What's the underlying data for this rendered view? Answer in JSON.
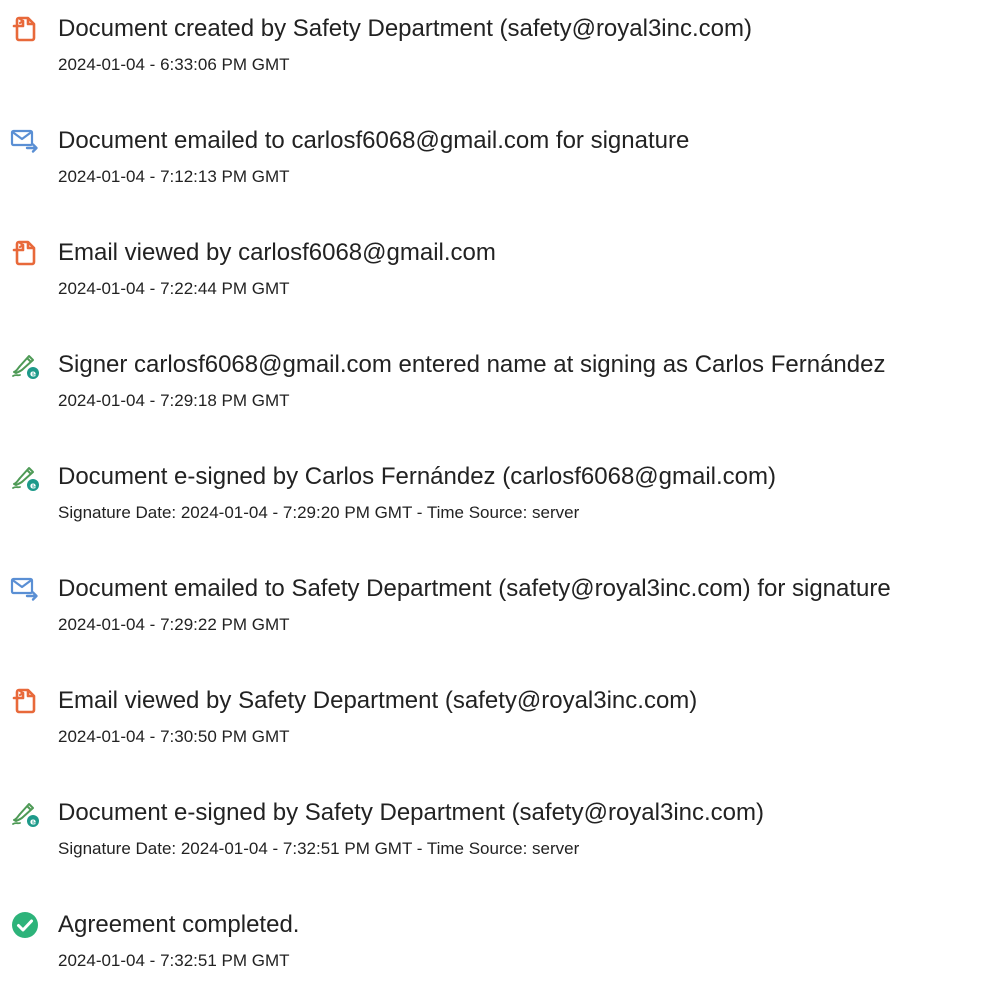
{
  "events": [
    {
      "icon": "document-created-icon",
      "text": "Document created by Safety Department (safety@royal3inc.com)",
      "detail": "2024-01-04 - 6:33:06 PM GMT"
    },
    {
      "icon": "email-sent-icon",
      "text": "Document emailed to carlosf6068@gmail.com for signature",
      "detail": "2024-01-04 - 7:12:13 PM GMT"
    },
    {
      "icon": "document-viewed-icon",
      "text": "Email viewed by carlosf6068@gmail.com",
      "detail": "2024-01-04 - 7:22:44 PM GMT"
    },
    {
      "icon": "signature-pen-icon",
      "text": "Signer carlosf6068@gmail.com entered name at signing as Carlos Fernández",
      "detail": "2024-01-04 - 7:29:18 PM GMT"
    },
    {
      "icon": "signature-pen-icon",
      "text": "Document e-signed by Carlos Fernández (carlosf6068@gmail.com)",
      "detail": "Signature Date: 2024-01-04 - 7:29:20 PM GMT - Time Source: server"
    },
    {
      "icon": "email-sent-icon",
      "text": "Document emailed to Safety Department (safety@royal3inc.com) for signature",
      "detail": "2024-01-04 - 7:29:22 PM GMT"
    },
    {
      "icon": "document-viewed-icon",
      "text": "Email viewed by Safety Department (safety@royal3inc.com)",
      "detail": "2024-01-04 - 7:30:50 PM GMT"
    },
    {
      "icon": "signature-pen-icon",
      "text": "Document e-signed by Safety Department (safety@royal3inc.com)",
      "detail": "Signature Date: 2024-01-04 - 7:32:51 PM GMT - Time Source: server"
    },
    {
      "icon": "checkmark-circle-icon",
      "text": "Agreement completed.",
      "detail": "2024-01-04 - 7:32:51 PM GMT"
    }
  ],
  "colors": {
    "document_icon": "#e8693a",
    "email_icon": "#5a8fd4",
    "signature_icon": "#1e9a8a",
    "completed_icon": "#2db37a",
    "text": "#222222"
  }
}
